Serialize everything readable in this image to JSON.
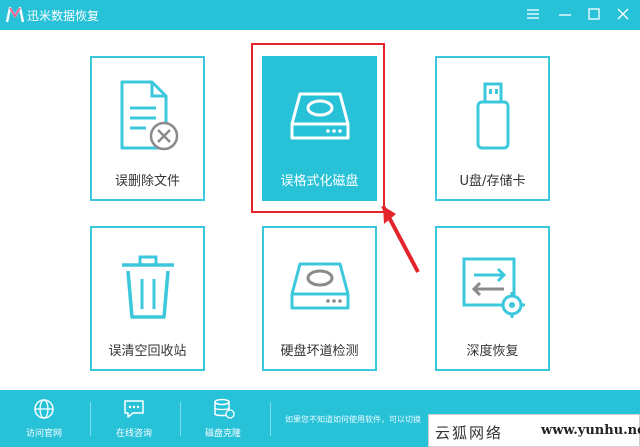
{
  "app": {
    "title": "迅米数据恢复"
  },
  "window_controls": {
    "menu_icon": "menu-icon",
    "minimize_icon": "minimize-icon",
    "maximize_icon": "maximize-icon",
    "close_icon": "close-icon"
  },
  "tiles": [
    {
      "label": "误删除文件",
      "icon": "deleted-file-icon",
      "selected": false
    },
    {
      "label": "误格式化磁盘",
      "icon": "hard-disk-icon",
      "selected": true
    },
    {
      "label": "U盘/存储卡",
      "icon": "usb-drive-icon",
      "selected": false
    },
    {
      "label": "误清空回收站",
      "icon": "recycle-bin-icon",
      "selected": false
    },
    {
      "label": "硬盘坏道检测",
      "icon": "disk-check-icon",
      "selected": false
    },
    {
      "label": "深度恢复",
      "icon": "deep-recovery-icon",
      "selected": false
    }
  ],
  "bottombar": {
    "items": [
      {
        "label": "访问官网",
        "icon": "globe-icon"
      },
      {
        "label": "在线咨询",
        "icon": "chat-icon"
      },
      {
        "label": "磁盘克隆",
        "icon": "database-icon"
      }
    ],
    "tip": "如果您不知道如何使用软件，可以切换"
  },
  "watermark": {
    "text": "云狐网络",
    "url": "www.yunhu.net"
  },
  "colors": {
    "accent": "#27c1d8",
    "tile_border": "#3cc8dc",
    "highlight": "#e3242b"
  }
}
